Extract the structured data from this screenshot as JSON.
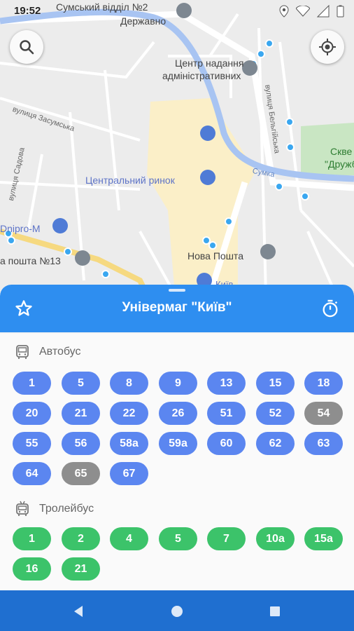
{
  "status": {
    "time": "19:52"
  },
  "map": {
    "labels": {
      "sumy_dept": "Сумський відділ №2",
      "derzhavno": "Державно",
      "admin1": "Центр надання",
      "admin2": "адміністративних",
      "street_zasumska": "вулиця Засумська",
      "street_sadova": "вулиця Садова",
      "street_bielokopytova": "вулиця Бельгійська",
      "central_market": "Центральний ринок",
      "dnipro_m": "Dnipro-M",
      "nova_poshta": "Нова Пошта",
      "poshta_13": "а пошта №13",
      "skver1": "Скве",
      "skver2": "\"Дружб",
      "sumka": "Сумка",
      "kyiv_small": "Київ"
    }
  },
  "sheet": {
    "title": "Універмаг \"Київ\"",
    "bus": {
      "label": "Автобус",
      "routes": [
        {
          "n": "1",
          "active": true
        },
        {
          "n": "5",
          "active": true
        },
        {
          "n": "8",
          "active": true
        },
        {
          "n": "9",
          "active": true
        },
        {
          "n": "13",
          "active": true
        },
        {
          "n": "15",
          "active": true
        },
        {
          "n": "18",
          "active": true
        },
        {
          "n": "20",
          "active": true
        },
        {
          "n": "21",
          "active": true
        },
        {
          "n": "22",
          "active": true
        },
        {
          "n": "26",
          "active": true
        },
        {
          "n": "51",
          "active": true
        },
        {
          "n": "52",
          "active": true
        },
        {
          "n": "54",
          "active": false
        },
        {
          "n": "55",
          "active": true
        },
        {
          "n": "56",
          "active": true
        },
        {
          "n": "58а",
          "active": true
        },
        {
          "n": "59а",
          "active": true
        },
        {
          "n": "60",
          "active": true
        },
        {
          "n": "62",
          "active": true
        },
        {
          "n": "63",
          "active": true
        },
        {
          "n": "64",
          "active": true
        },
        {
          "n": "65",
          "active": false
        },
        {
          "n": "67",
          "active": true
        }
      ]
    },
    "trolleybus": {
      "label": "Тролейбус",
      "routes": [
        "1",
        "2",
        "4",
        "5",
        "7",
        "10а",
        "15а",
        "16",
        "21"
      ]
    }
  },
  "colors": {
    "header": "#2e8ef0",
    "bus_chip": "#5b86f0",
    "bus_chip_inactive": "#8e8e8e",
    "trolley_chip": "#3cc36a",
    "navbar": "#1f6fd0"
  }
}
